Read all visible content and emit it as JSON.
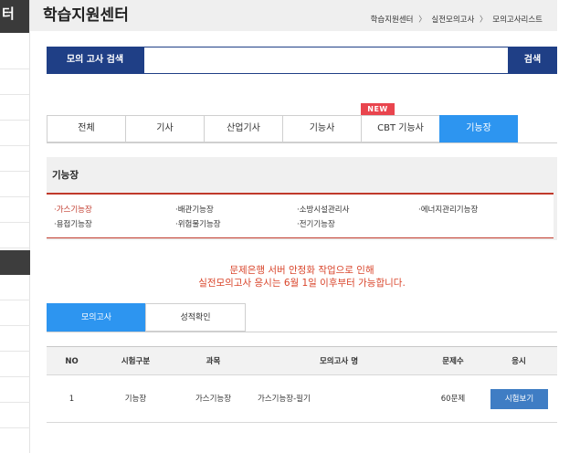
{
  "sidebar": {
    "title_fragment": "터"
  },
  "header": {
    "title": "학습지원센터",
    "breadcrumb": [
      "학습지원센터",
      "실전모의고사",
      "모의고사리스트"
    ],
    "breadcrumb_sep": "〉"
  },
  "search": {
    "label": "모의 고사 검색",
    "selected_value": "",
    "button_label": "검색"
  },
  "tabs": {
    "items": [
      "전체",
      "기사",
      "산업기사",
      "기능사",
      "CBT 기능사",
      "기능장"
    ],
    "active": "기능장",
    "new_badge": "NEW"
  },
  "category": {
    "title": "기능장",
    "items": [
      "·가스기능장",
      "·배관기능장",
      "·소방시설관리사",
      "·에너지관리기능장",
      "·용접기능장",
      "·위험물기능장",
      "·전기기능장"
    ],
    "active": "·가스기능장"
  },
  "notice": {
    "line1": "문제은행 서버 안정화 작업으로 인해",
    "line2": "실전모의고사 응시는 6월 1일 이후부터 가능합니다."
  },
  "subtabs": {
    "items": [
      "모의고사",
      "성적확인"
    ],
    "active": "모의고사"
  },
  "table": {
    "headers": [
      "NO",
      "시험구분",
      "과목",
      "모의고사 명",
      "문제수",
      "응시"
    ],
    "rows": [
      {
        "no": "1",
        "type": "기능장",
        "subject": "가스기능장",
        "name": "가스기능장-필기",
        "count": "60문제",
        "action": "시험보기"
      }
    ]
  },
  "colors": {
    "primary_navy": "#1f3f86",
    "active_blue": "#2d95f0",
    "accent_red": "#c0392b",
    "badge_red": "#e9454e",
    "button_blue": "#3f7dc4"
  }
}
